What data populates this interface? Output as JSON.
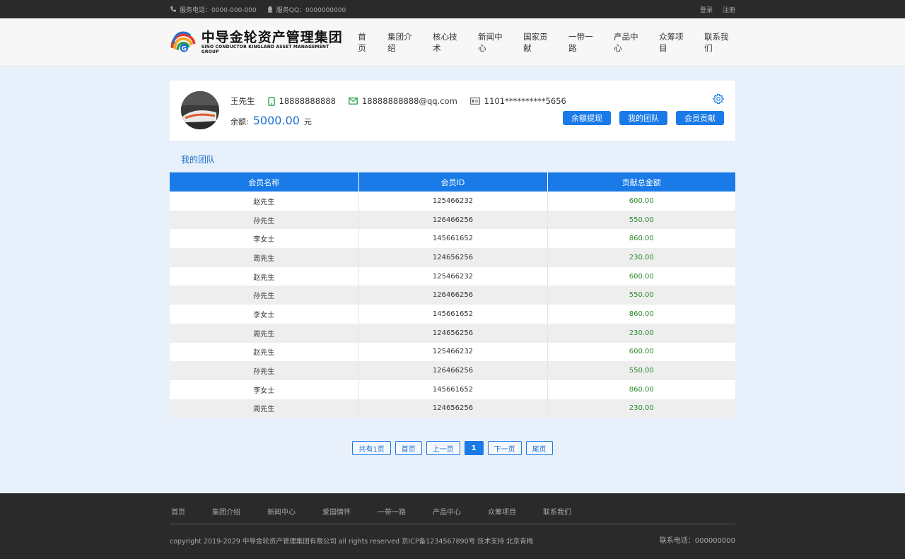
{
  "topbar": {
    "phone": "服务电话：0000-000-000",
    "qq": "服务QQ：0000000000",
    "login": "登录",
    "register": "注册"
  },
  "header": {
    "logo_cn": "中导金轮资产管理集团",
    "logo_en": "SINO CONDUCTOR KINGLAND ASSET MANAGEMENT GROUP",
    "nav": [
      "首页",
      "集团介绍",
      "核心技术",
      "新闻中心",
      "国家贡献",
      "一带一路",
      "产品中心",
      "众筹项目",
      "联系我们"
    ]
  },
  "profile": {
    "name": "王先生",
    "phone": "18888888888",
    "email": "18888888888@qq.com",
    "id_number": "1101**********5656",
    "balance_label": "余额:",
    "balance_amount": "5000.00",
    "balance_unit": "元",
    "actions": [
      "余额提现",
      "我的团队",
      "会员贡献"
    ]
  },
  "section_title": "我的团队",
  "table": {
    "headers": [
      "会员名称",
      "会员ID",
      "贡献总金额"
    ],
    "rows": [
      [
        "赵先生",
        "125466232",
        "600.00"
      ],
      [
        "孙先生",
        "126466256",
        "550.00"
      ],
      [
        "李女士",
        "145661652",
        "860.00"
      ],
      [
        "周先生",
        "124656256",
        "230.00"
      ],
      [
        "赵先生",
        "125466232",
        "600.00"
      ],
      [
        "孙先生",
        "126466256",
        "550.00"
      ],
      [
        "李女士",
        "145661652",
        "860.00"
      ],
      [
        "周先生",
        "124656256",
        "230.00"
      ],
      [
        "赵先生",
        "125466232",
        "600.00"
      ],
      [
        "孙先生",
        "126466256",
        "550.00"
      ],
      [
        "李女士",
        "145661652",
        "860.00"
      ],
      [
        "周先生",
        "124656256",
        "230.00"
      ]
    ]
  },
  "pager": {
    "total": "共有1页",
    "first": "首页",
    "prev": "上一页",
    "current": "1",
    "next": "下一页",
    "last": "尾页"
  },
  "footer": {
    "nav": [
      "首页",
      "集团介绍",
      "新闻中心",
      "爱国情怀",
      "一带一路",
      "产品中心",
      "众筹项目",
      "联系我们"
    ],
    "copyright": "copyright 2019-2029 中导金轮资产管理集团有限公司 all rights reserved 京ICP备1234567890号   技术支持 北京青梅",
    "phone": "联系电话：000000000"
  },
  "colors": {
    "primary": "#1a7ae8",
    "dark_bar": "#2a2a2a",
    "page_bg": "#e8f0fb",
    "amount_green": "#2e8b2e"
  }
}
